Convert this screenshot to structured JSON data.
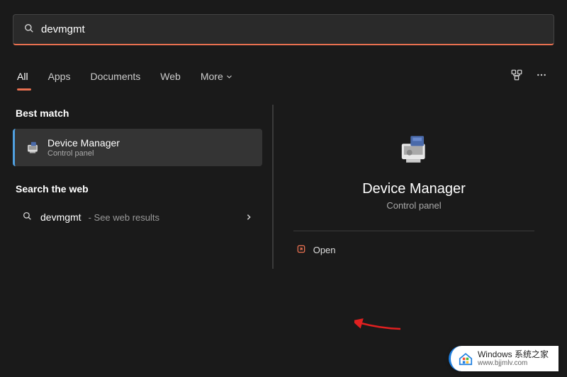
{
  "search": {
    "value": "devmgmt"
  },
  "tabs": {
    "all": "All",
    "apps": "Apps",
    "documents": "Documents",
    "web": "Web",
    "more": "More"
  },
  "left": {
    "bestMatch": "Best match",
    "result": {
      "title": "Device Manager",
      "sub": "Control panel"
    },
    "searchWeb": "Search the web",
    "webQuery": "devmgmt",
    "webSub": " - See web results"
  },
  "right": {
    "title": "Device Manager",
    "sub": "Control panel",
    "open": "Open"
  },
  "watermark": {
    "line1": "Windows 系统之家",
    "line2": "www.bjjmlv.com"
  }
}
